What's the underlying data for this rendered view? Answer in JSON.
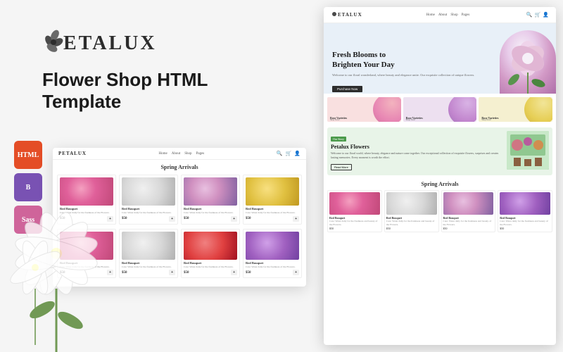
{
  "brand": {
    "name": "PETALUX",
    "tagline": "Flower Shop HTML Template"
  },
  "badges": [
    {
      "id": "html",
      "label": "HTML",
      "color": "#e44d26"
    },
    {
      "id": "bs",
      "label": "B",
      "color": "#7952b3"
    },
    {
      "id": "sass",
      "label": "Sass",
      "color": "#cf649a"
    }
  ],
  "preview": {
    "section_title": "Spring Arrivals",
    "nav": {
      "logo": "PETALUX",
      "links": [
        "Home",
        "About",
        "Shop",
        "Pages"
      ]
    }
  },
  "hero": {
    "line1": "Fresh Blooms to",
    "line2": "Brighten Your Day",
    "subtitle": "Welcome to our floral wonderland, where beauty and elegance unite. Our exquisite collection of unique flowers.",
    "button": "Purchase Now"
  },
  "categories": [
    {
      "label": "Rose Varieties",
      "btn": "Shop Now!",
      "color": "pink"
    },
    {
      "label": "Rose Varieties",
      "btn": "Shop Now!",
      "color": "lavender"
    },
    {
      "label": "Rose Varieties",
      "btn": "Shop Now!",
      "color": "yellow"
    }
  ],
  "about": {
    "badge": "Our Story",
    "title": "Petalux Flowers",
    "desc": "Welcome to our floral world, where beauty, elegance and nature come together. Our exceptional collection of exquisite flowers, surprises and creates lasting memories. Every moment is worth the effort.",
    "button": "Read More"
  },
  "spring": {
    "title": "Spring Arrivals",
    "products": [
      {
        "name": "Red Bouquet",
        "price": "$50",
        "color": "flower-pink"
      },
      {
        "name": "Red Bouquet",
        "price": "$50",
        "color": "flower-white"
      },
      {
        "name": "Red Bouquet",
        "price": "$50",
        "color": "flower-mixed"
      },
      {
        "name": "Red Bouquet",
        "price": "$50",
        "color": "flower-purple"
      }
    ]
  },
  "left_products": [
    {
      "name": "Red Bouquet",
      "desc": "Care: Water daily for the freshness of the Flowers.",
      "price": "$50",
      "color": "flower-pink"
    },
    {
      "name": "Red Bouquet",
      "desc": "Care: Water daily for the freshness of the Flowers.",
      "price": "$50",
      "color": "flower-white"
    },
    {
      "name": "Red Bouquet",
      "desc": "Care: Water daily for the freshness of the Flowers.",
      "price": "$50",
      "color": "flower-mixed"
    },
    {
      "name": "Red Bouquet",
      "desc": "Care: Water daily for the freshness of the Flowers.",
      "price": "$50",
      "color": "flower-yellow"
    },
    {
      "name": "Red Bouquet",
      "desc": "Care: Water daily for the freshness of the Flowers.",
      "price": "$50",
      "color": "flower-pink"
    },
    {
      "name": "Red Bouquet",
      "desc": "Care: Water daily for the freshness of the Flowers.",
      "price": "$50",
      "color": "flower-white"
    },
    {
      "name": "Red Bouquet",
      "desc": "Care: Water daily for the freshness of the Flowers.",
      "price": "$50",
      "color": "flower-tulip"
    },
    {
      "name": "Red Bouquet",
      "desc": "Care: Water daily for the freshness of the Flowers.",
      "price": "$50",
      "color": "flower-purple"
    }
  ]
}
